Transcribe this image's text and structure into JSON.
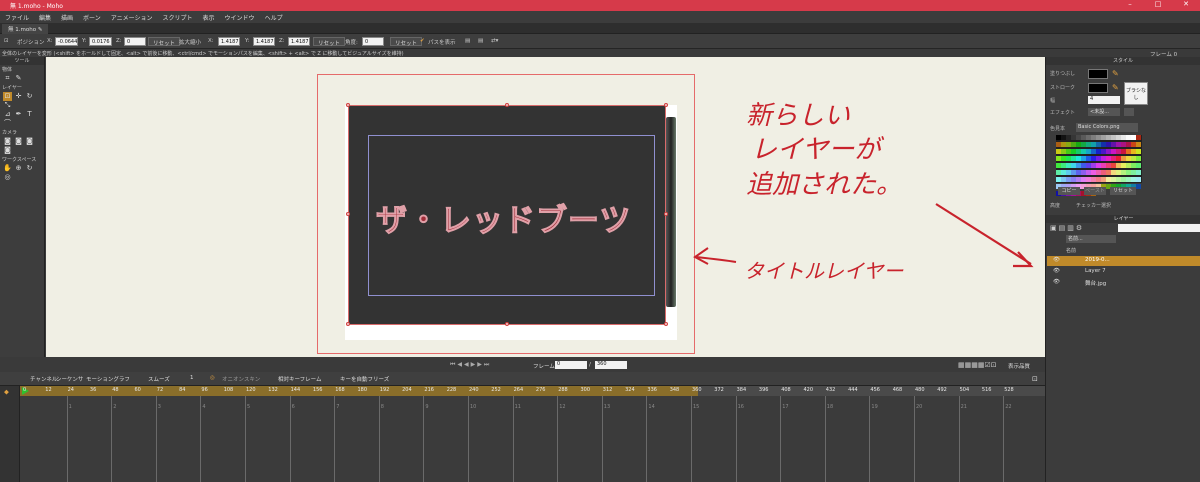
{
  "window": {
    "title": "無 1.moho - Moho"
  },
  "menu": [
    "ファイル",
    "編集",
    "描画",
    "ボーン",
    "アニメーション",
    "スクリプト",
    "表示",
    "ウインドウ",
    "ヘルプ"
  ],
  "tab": {
    "label": "無 1.moho"
  },
  "tool_options": {
    "position_label": "ポジション",
    "x_label": "X:",
    "x_value": "-0.0644",
    "y_label": "Y:",
    "y_value": "0.0176",
    "z_label": "Z:",
    "z_value": "0",
    "reset1": "リセット",
    "scale_label": "拡大縮小",
    "sx_label": "X:",
    "sx_value": "1.4187",
    "sy_label": "Y:",
    "sy_value": "1.4187",
    "sz_label": "Z:",
    "sz_value": "1.4187",
    "reset2": "リセット",
    "angle_label": "角度:",
    "angle_value": "0",
    "reset3": "リセット",
    "path_label": "パスを表示"
  },
  "hint_text": "全体のレイヤーを変形 (<shift> をホールドして固定、<alt> で前後に移動、<ctrl/cmd> でモーションパスを編集、<shift> + <alt> で Z に移動してビジュアルサイズを維持)",
  "frame_indicator": "フレーム 0",
  "tools_panel": {
    "header": "ツール",
    "sections": [
      "物体",
      "レイヤー",
      "カメラ",
      "ワークスペース"
    ]
  },
  "canvas": {
    "title_text": "ザ・レッドブーツ"
  },
  "annotations": {
    "new_layer": [
      "新らしい",
      "レイヤーが",
      "追加された。"
    ],
    "title_layer": "タイトルレイヤー"
  },
  "style_panel": {
    "header": "スタイル",
    "fill_label": "塗りつぶし",
    "stroke_label": "ストローク",
    "width_label": "幅",
    "width_value": "4",
    "brush_label": "ブラシなし",
    "effect_label": "エフェクト",
    "effect_value": "<未設...",
    "palette_label": "色見本",
    "palette_value": "Basic Colors.png",
    "copy": "コピー",
    "paste": "ペースト",
    "reset": "リセット",
    "advanced": "高度",
    "checker": "チェッカー選択"
  },
  "layers_panel": {
    "header": "レイヤー",
    "name_col": "名前",
    "filter": "名前...",
    "layers": [
      {
        "name": "2019-0...",
        "selected": true
      },
      {
        "name": "Layer 7",
        "selected": false
      },
      {
        "name": "舞台.jpg",
        "selected": false
      }
    ]
  },
  "playback": {
    "frame_label": "フレーム",
    "frame_value": "0",
    "of": "/",
    "end_value": "360",
    "display_quality": "表示品質"
  },
  "timeline": {
    "tabs": [
      "チャンネル",
      "シーケンサ",
      "モーショングラフ"
    ],
    "interp": "スムーズ",
    "interp_num": "1",
    "onion": "オニオンスキン",
    "relative": "相対キーフレーム",
    "auto_freeze": "キーを自動フリーズ",
    "ruler": [
      "0",
      "12",
      "24",
      "36",
      "48",
      "60",
      "72",
      "84",
      "96",
      "108",
      "120",
      "132",
      "144",
      "156",
      "168",
      "180",
      "192",
      "204",
      "216",
      "228",
      "240",
      "252",
      "264",
      "276",
      "288",
      "300",
      "312",
      "324",
      "336",
      "348",
      "360",
      "372",
      "384",
      "396",
      "408",
      "420",
      "432",
      "444",
      "456",
      "468",
      "480",
      "492",
      "504",
      "516",
      "528"
    ],
    "second_marks": [
      "1",
      "2",
      "3",
      "4",
      "5",
      "6",
      "7",
      "8",
      "9",
      "10",
      "11",
      "12",
      "13",
      "14",
      "15",
      "16",
      "17",
      "18",
      "19",
      "20",
      "21",
      "22"
    ]
  },
  "colors": {
    "titlebar": "#d63a4a",
    "annotation": "#c8232c",
    "selected_layer": "#c08a2a"
  }
}
